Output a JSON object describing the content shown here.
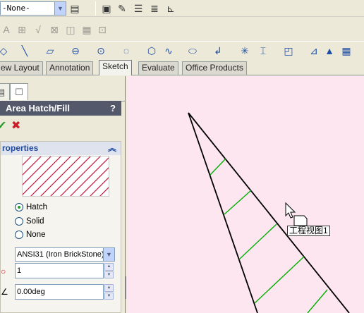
{
  "toolbar_top": {
    "layer_select": "-None-",
    "icons": [
      "layer-manager-icon",
      "layer-properties-icon",
      "color-icon",
      "line-style-icon",
      "line-thickness-icon",
      "hide-show-edges-icon"
    ]
  },
  "toolbar_annotation": {
    "icons": [
      "note-icon",
      "balloon-icon",
      "surface-finish-icon",
      "weld-symbol-icon",
      "gtol-icon",
      "datum-icon"
    ]
  },
  "toolbar_sketch": {
    "icons": [
      "smart-dimension-icon",
      "line-icon",
      "rectangle-icon",
      "slot-icon",
      "circle-icon",
      "arc-icon",
      "polygon-icon",
      "spline-icon",
      "ellipse-icon",
      "fillet-icon",
      "point-icon",
      "trim-icon",
      "offset-icon",
      "mirror-icon",
      "dim-icon",
      "grid-icon"
    ]
  },
  "tabs": [
    "ew Layout",
    "Annotation",
    "Sketch",
    "Evaluate",
    "Office Products"
  ],
  "active_tab": "Sketch",
  "panel": {
    "title": "Area Hatch/Fill",
    "help": "?",
    "ok": "✔",
    "cancel": "✖",
    "section": "roperties",
    "options": [
      "Hatch",
      "Solid",
      "None"
    ],
    "selected_option": "Hatch",
    "pattern": "ANSI31 (Iron BrickStone)",
    "scale": "1",
    "angle": "0.00deg"
  },
  "canvas": {
    "tooltip": "工程视图1",
    "colors": {
      "background": "#fde6ef",
      "outline": "#000000",
      "hatch": "#00b000"
    }
  }
}
